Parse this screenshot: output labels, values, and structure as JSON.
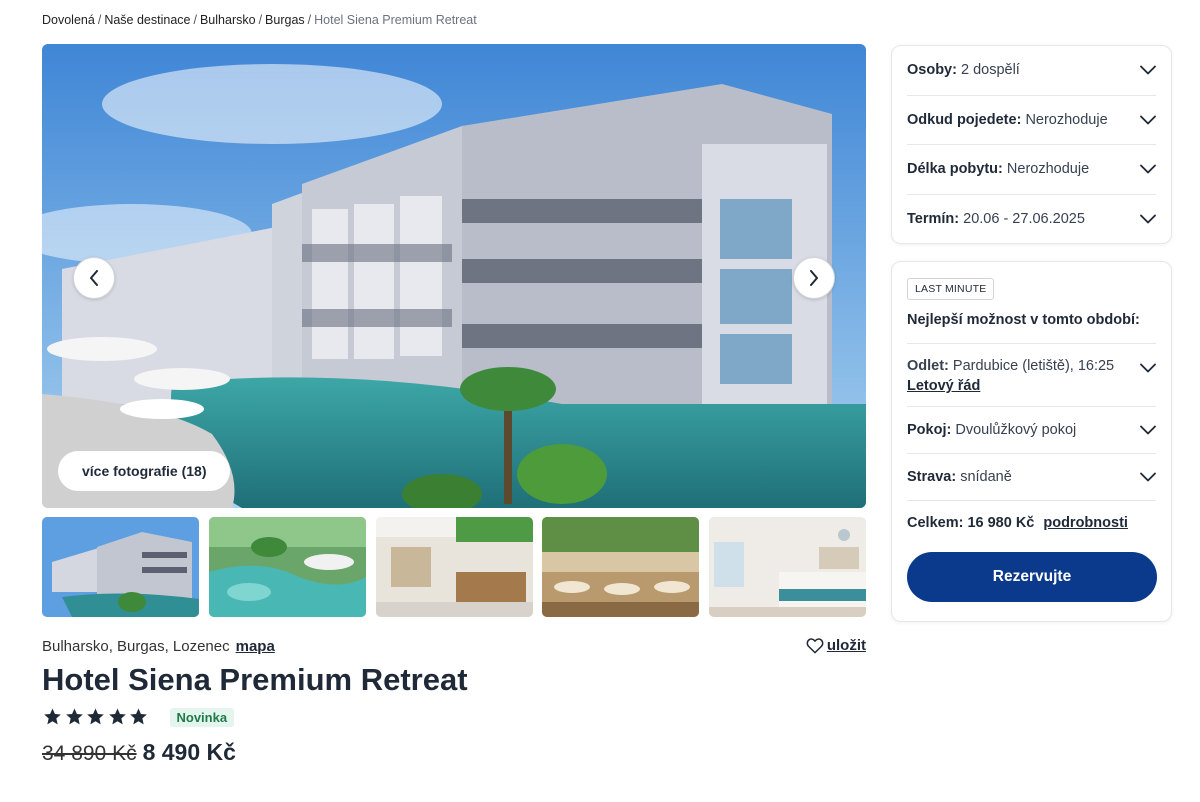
{
  "breadcrumb": [
    "Dovolená",
    "Naše destinace",
    "Bulharsko",
    "Burgas"
  ],
  "breadcrumb_current": "Hotel Siena Premium Retreat",
  "gallery": {
    "more_photos": "více fotografie (18)",
    "thumbnails": [
      "hotel-facade-pool",
      "lagoon-pool",
      "hotel-lobby",
      "restaurant",
      "hotel-room"
    ]
  },
  "hotel": {
    "location": "Bulharsko, Burgas, Lozenec",
    "map_link": "mapa",
    "save_label": "uložit",
    "name": "Hotel Siena Premium Retreat",
    "stars": 5,
    "badge": "Novinka",
    "old_price": "34 890 Kč",
    "price": "8 490 Kč"
  },
  "search": {
    "persons_label": "Osoby:",
    "persons_value": "2 dospělí",
    "departure_label": "Odkud pojedete:",
    "departure_value": "Nerozhoduje",
    "length_label": "Délka pobytu:",
    "length_value": "Nerozhoduje",
    "date_label": "Termín:",
    "date_value": "20.06 - 27.06.2025"
  },
  "offer": {
    "badge": "LAST MINUTE",
    "heading": "Nejlepší možnost v tomto období:",
    "flight_label": "Odlet:",
    "flight_value": "Pardubice (letiště), 16:25",
    "schedule_link": "Letový řád",
    "room_label": "Pokoj:",
    "room_value": "Dvoulůžkový pokoj",
    "board_label": "Strava:",
    "board_value": "snídaně",
    "total_label": "Celkem: 16 980 Kč",
    "details_link": "podrobnosti",
    "reserve_button": "Rezervujte"
  },
  "colors": {
    "primary": "#0b3a8c",
    "badge_green_bg": "#e3f5ec",
    "badge_green_text": "#1f7a4a"
  },
  "icons": [
    "chevron-left-icon",
    "chevron-right-icon",
    "chevron-down-icon",
    "heart-icon",
    "star-icon"
  ]
}
